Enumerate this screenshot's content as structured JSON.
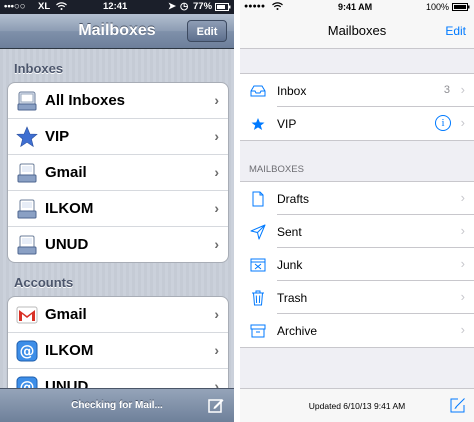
{
  "left": {
    "status": {
      "carrier": "XL",
      "time": "12:41",
      "battery": "77%"
    },
    "nav": {
      "title": "Mailboxes",
      "edit_label": "Edit"
    },
    "inboxes_header": "Inboxes",
    "inboxes": [
      {
        "label": "All Inboxes",
        "icon": "all-inboxes-icon"
      },
      {
        "label": "VIP",
        "icon": "star-icon"
      },
      {
        "label": "Gmail",
        "icon": "inbox-tray-icon"
      },
      {
        "label": "ILKOM",
        "icon": "inbox-tray-icon"
      },
      {
        "label": "UNUD",
        "icon": "inbox-tray-icon"
      }
    ],
    "accounts_header": "Accounts",
    "accounts": [
      {
        "label": "Gmail",
        "icon": "gmail-icon"
      },
      {
        "label": "ILKOM",
        "icon": "at-sign-icon"
      },
      {
        "label": "UNUD",
        "icon": "at-sign-icon"
      }
    ],
    "toolbar_status": "Checking for Mail...",
    "colors": {
      "nav": "#7f90aa",
      "star": "#3f6fd1"
    }
  },
  "right": {
    "status": {
      "time": "9:41 AM",
      "battery": "100%"
    },
    "nav": {
      "title": "Mailboxes",
      "edit_label": "Edit"
    },
    "top_rows": [
      {
        "label": "Inbox",
        "count": "3",
        "icon": "inbox-tray-icon"
      },
      {
        "label": "VIP",
        "icon": "star-icon",
        "info": "i"
      }
    ],
    "mailboxes_header": "MAILBOXES",
    "mailboxes": [
      {
        "label": "Drafts",
        "icon": "document-icon"
      },
      {
        "label": "Sent",
        "icon": "paper-plane-icon"
      },
      {
        "label": "Junk",
        "icon": "junk-box-icon"
      },
      {
        "label": "Trash",
        "icon": "trash-icon"
      },
      {
        "label": "Archive",
        "icon": "archive-box-icon"
      }
    ],
    "toolbar_status": "Updated 6/10/13 9:41 AM",
    "colors": {
      "accent": "#007aff",
      "background": "#efeff4"
    }
  }
}
